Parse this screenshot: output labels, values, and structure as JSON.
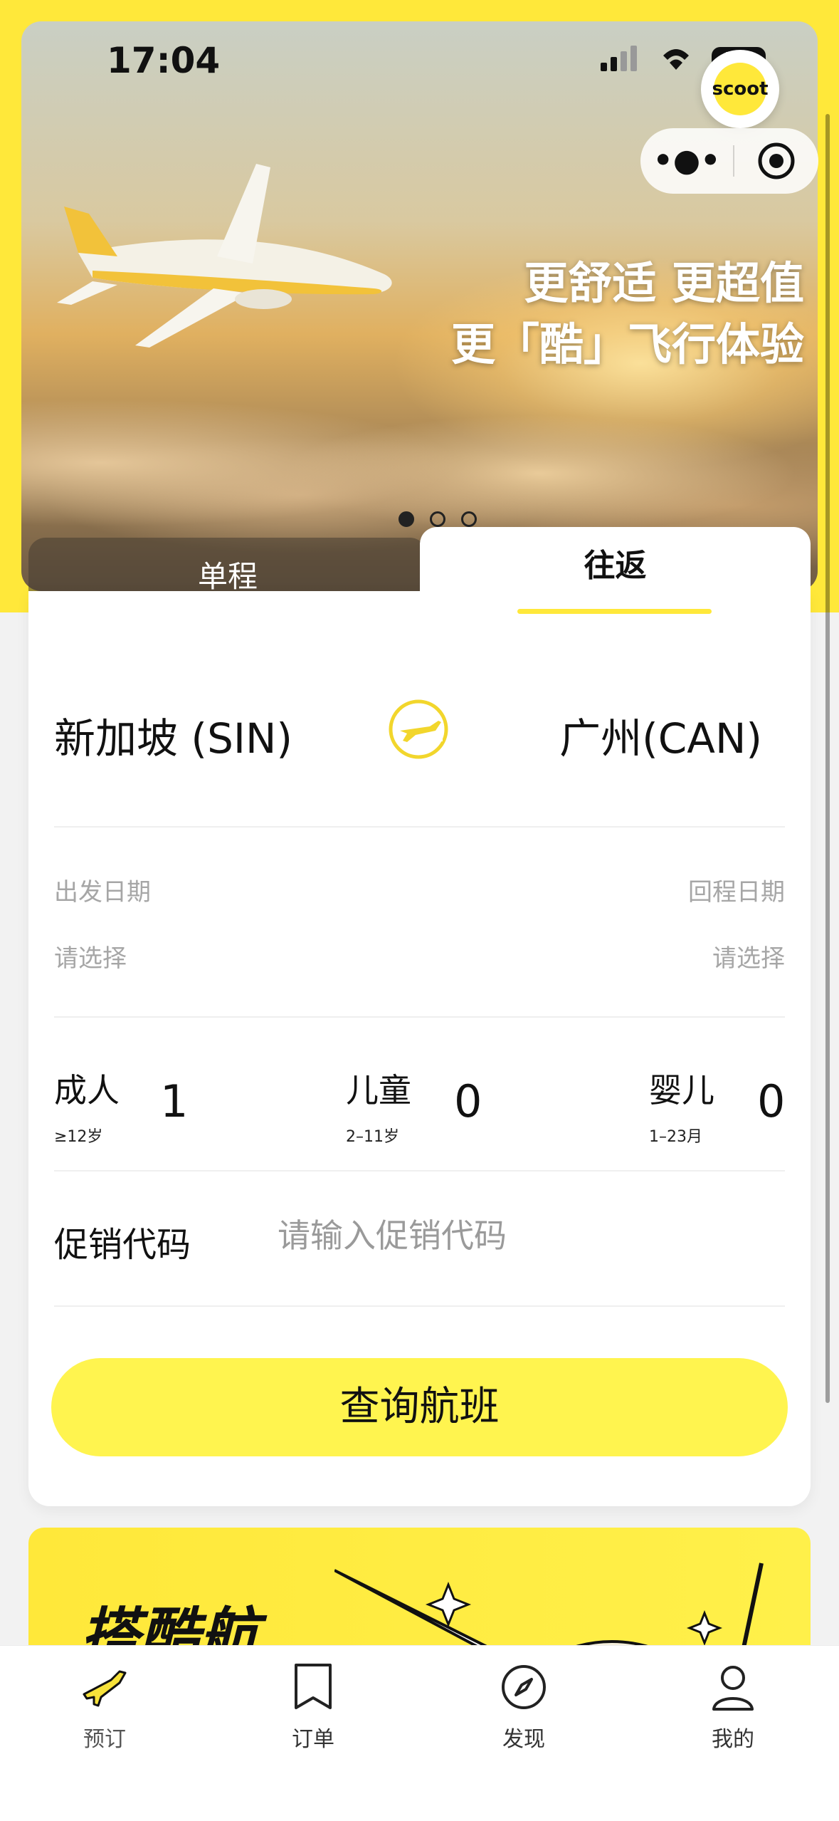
{
  "status_bar": {
    "time": "17:04",
    "battery": "50"
  },
  "brand": {
    "logo_text": "scoot",
    "accent_color": "#ffe83a"
  },
  "capsule": {
    "more_icon": "more-dots-icon",
    "close_icon": "target-close-icon"
  },
  "hero": {
    "slogan_line1": "更舒适 更超值",
    "slogan_line2": "更「酷」飞行体验",
    "slides": 3,
    "active_slide": 1
  },
  "trip_tabs": {
    "one_way": "单程",
    "round_trip": "往返",
    "selected": "往返"
  },
  "route": {
    "from": "新加坡 (SIN)",
    "to": "广州(CAN)"
  },
  "dates": {
    "depart_label": "出发日期",
    "depart_value": "请选择",
    "return_label": "回程日期",
    "return_value": "请选择"
  },
  "passengers": {
    "adult": {
      "label": "成人",
      "note": "≥12岁",
      "count": "1"
    },
    "child": {
      "label": "儿童",
      "note": "2–11岁",
      "count": "0"
    },
    "infant": {
      "label": "婴儿",
      "note": "1–23月",
      "count": "0"
    }
  },
  "promo": {
    "label": "促销代码",
    "placeholder": "请输入促销代码",
    "value": ""
  },
  "search_button": "查询航班",
  "promo_banner": {
    "title": "搭酷航"
  },
  "tabbar": {
    "items": [
      {
        "label": "预订",
        "icon": "plane-icon"
      },
      {
        "label": "订单",
        "icon": "bookmark-icon"
      },
      {
        "label": "发现",
        "icon": "compass-icon"
      },
      {
        "label": "我的",
        "icon": "user-icon"
      }
    ],
    "active": "预订"
  }
}
